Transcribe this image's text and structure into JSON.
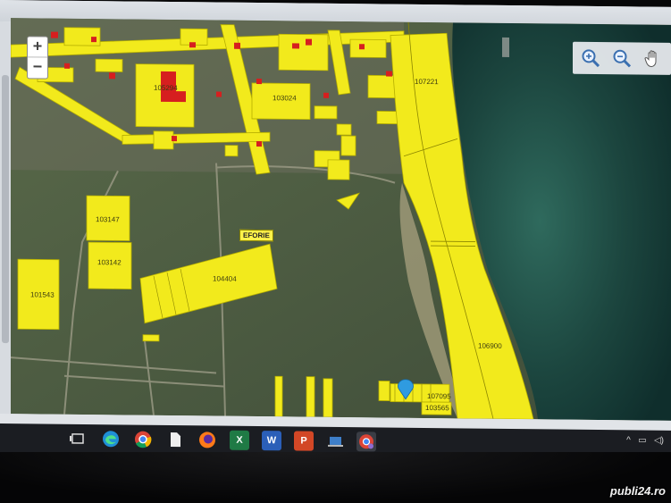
{
  "map": {
    "place_name": "EFORIE",
    "parcels": [
      {
        "id": "105294"
      },
      {
        "id": "103024"
      },
      {
        "id": "107221"
      },
      {
        "id": "103147"
      },
      {
        "id": "103142"
      },
      {
        "id": "101543"
      },
      {
        "id": "104404"
      },
      {
        "id": "106900"
      },
      {
        "id": "107095"
      },
      {
        "id": "103565"
      }
    ],
    "colors": {
      "parcel_fill": "#f2ea1c",
      "building": "#d61f1f",
      "land": "#4d5d43",
      "sea": "#1f4a44"
    }
  },
  "controls": {
    "zoom_in": "+",
    "zoom_out": "−",
    "tools": [
      "zoom-in-icon",
      "zoom-out-icon",
      "pan-hand-icon"
    ]
  },
  "taskbar": {
    "apps": [
      "task-view-icon",
      "edge-icon",
      "chrome-icon",
      "file-icon",
      "firefox-icon",
      "excel-icon",
      "word-icon",
      "powerpoint-icon",
      "network-icon",
      "chrome-profile-icon"
    ],
    "excel_letter": "X",
    "word_letter": "W",
    "powerpoint_letter": "P"
  },
  "watermark": "publi24.ro"
}
